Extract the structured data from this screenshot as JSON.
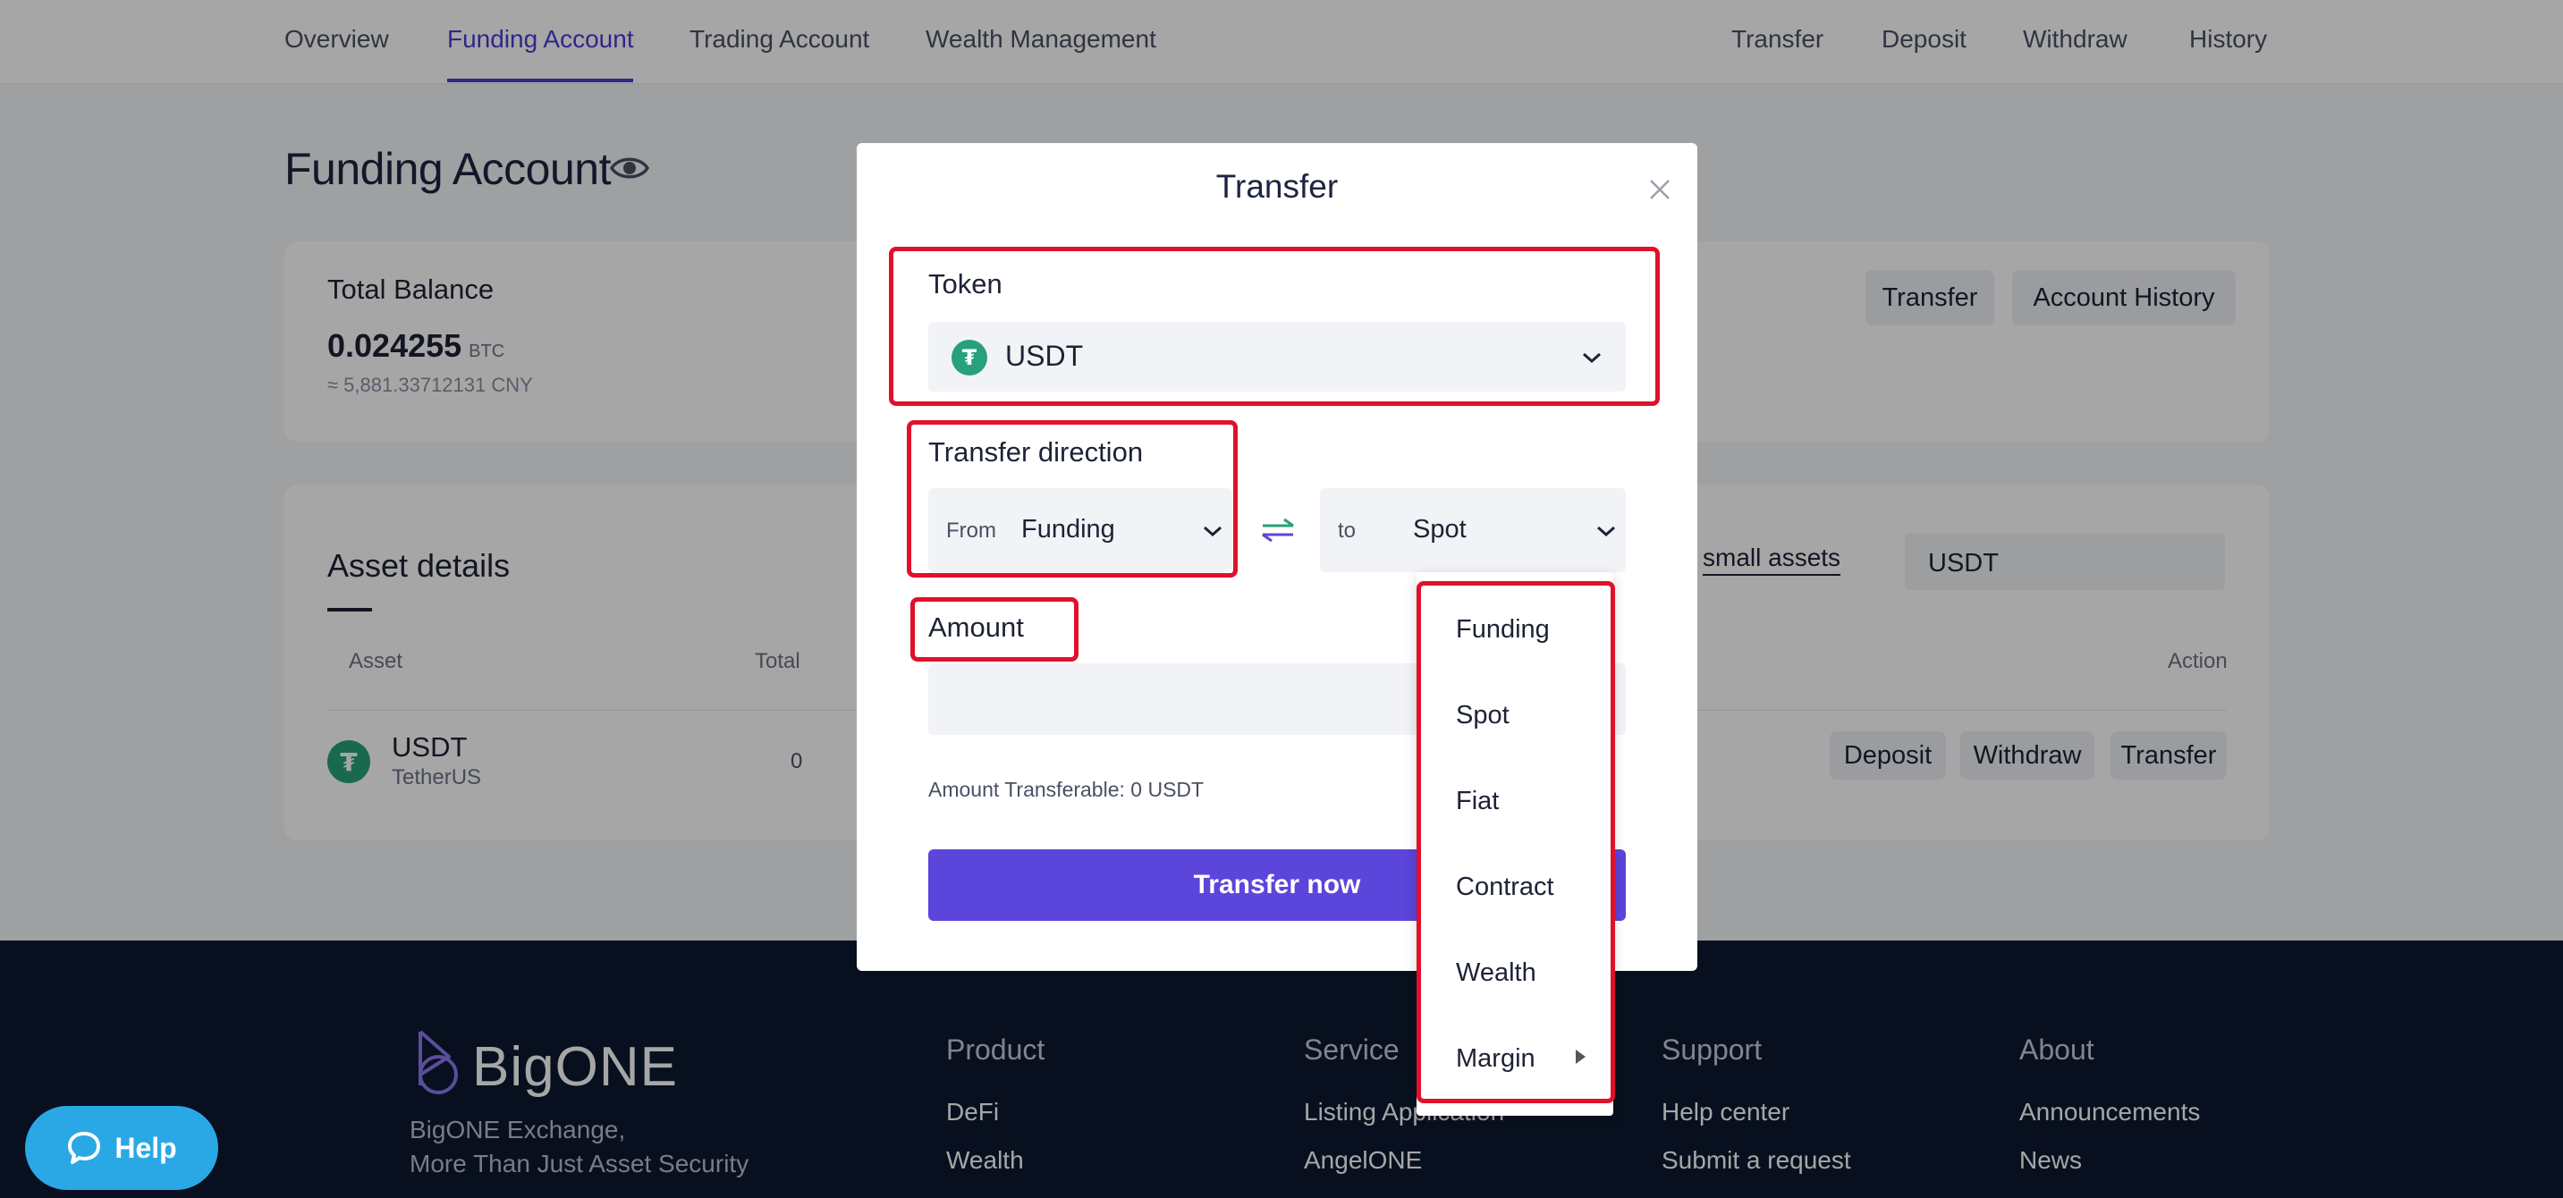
{
  "topnav": {
    "left_tabs": [
      "Overview",
      "Funding Account",
      "Trading Account",
      "Wealth Management"
    ],
    "active_tab": "Funding Account",
    "right_links": [
      "Transfer",
      "Deposit",
      "Withdraw",
      "History"
    ]
  },
  "page": {
    "title": "Funding Account",
    "balance": {
      "label": "Total Balance",
      "value": "0.024255",
      "unit": "BTC",
      "cny": "≈ 5,881.33712131",
      "cny_unit": "CNY",
      "transfer_label": "Transfer",
      "history_label": "Account History"
    },
    "assets": {
      "title": "Asset details",
      "columns": {
        "asset": "Asset",
        "total": "Total",
        "action": "Action"
      },
      "small_assets_label": "small assets",
      "search_value": "USDT",
      "rows": [
        {
          "symbol": "USDT",
          "name": "TetherUS",
          "total": "0",
          "actions": [
            "Deposit",
            "Withdraw",
            "Transfer"
          ]
        }
      ]
    }
  },
  "modal": {
    "title": "Transfer",
    "token_label": "Token",
    "token_value": "USDT",
    "direction_label": "Transfer direction",
    "from_prefix": "From",
    "from_value": "Funding",
    "to_prefix": "to",
    "to_value": "Spot",
    "amount_label": "Amount",
    "amount_value": "",
    "transferable": "Amount Transferable: 0 USDT",
    "submit_label": "Transfer now",
    "to_options": [
      "Funding",
      "Spot",
      "Fiat",
      "Contract",
      "Wealth",
      "Margin"
    ]
  },
  "footer": {
    "brand": "BigONE",
    "tagline_1": "BigONE Exchange,",
    "tagline_2": "More Than Just Asset Security",
    "columns": [
      {
        "head": "Product",
        "links": [
          "DeFi",
          "Wealth"
        ]
      },
      {
        "head": "Service",
        "links": [
          "Listing Application",
          "AngelONE"
        ]
      },
      {
        "head": "Support",
        "links": [
          "Help center",
          "Submit a request"
        ]
      },
      {
        "head": "About",
        "links": [
          "Announcements",
          "News"
        ]
      }
    ]
  },
  "help": {
    "label": "Help"
  },
  "colors": {
    "accent": "#4b3bd4",
    "primary_button": "#5b45da",
    "tether": "#26a17b",
    "highlight": "#e0112b",
    "help": "#2aa8e6"
  }
}
